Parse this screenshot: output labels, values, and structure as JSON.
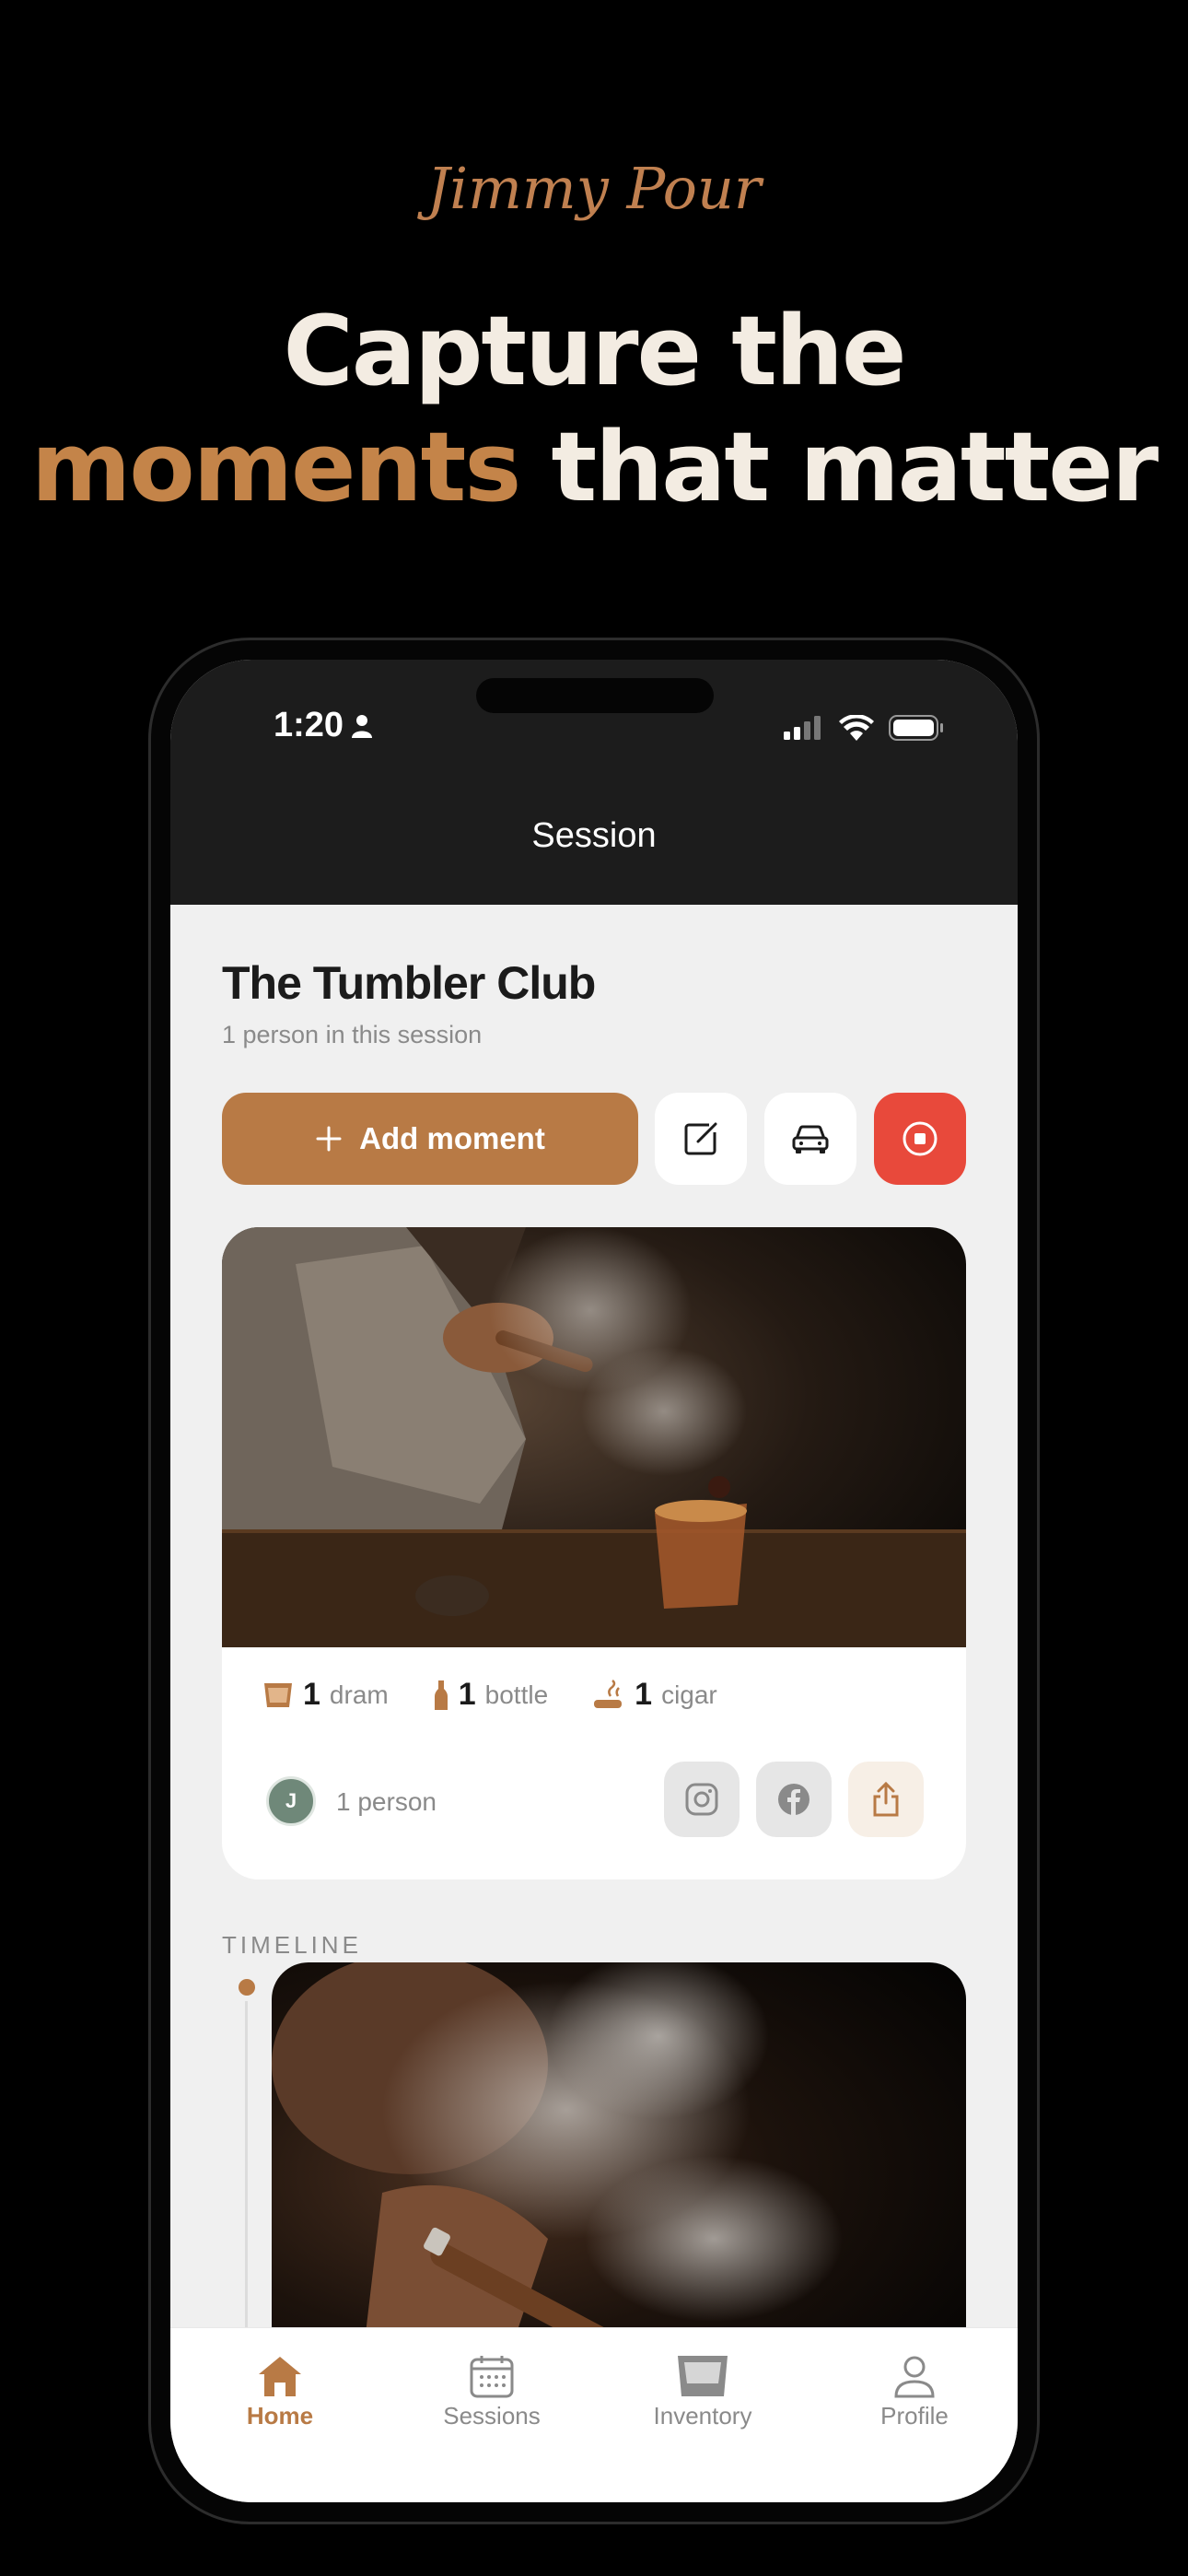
{
  "brand": "Jimmy Pour",
  "headline": {
    "line1": "Capture the",
    "accent": "moments",
    "rest": " that matter"
  },
  "status_bar": {
    "time": "1:20"
  },
  "nav": {
    "title": "Session"
  },
  "session": {
    "name": "The Tumbler Club",
    "subtitle": "1 person in this session"
  },
  "actions": {
    "add_moment": "Add moment"
  },
  "card": {
    "stats": [
      {
        "count": "1",
        "label": "dram",
        "icon": "glass-icon"
      },
      {
        "count": "1",
        "label": "bottle",
        "icon": "bottle-icon"
      },
      {
        "count": "1",
        "label": "cigar",
        "icon": "cigar-icon"
      }
    ],
    "avatar_initial": "J",
    "people": "1 person"
  },
  "timeline": {
    "label": "TIMELINE"
  },
  "tabs": [
    {
      "label": "Home",
      "icon": "home-icon",
      "active": true
    },
    {
      "label": "Sessions",
      "icon": "calendar-icon",
      "active": false
    },
    {
      "label": "Inventory",
      "icon": "glass-icon",
      "active": false
    },
    {
      "label": "Profile",
      "icon": "person-icon",
      "active": false
    }
  ],
  "colors": {
    "accent": "#b87a45",
    "cream": "#f3ece2",
    "stop": "#e8493b",
    "bar": "#1c1c1c"
  }
}
